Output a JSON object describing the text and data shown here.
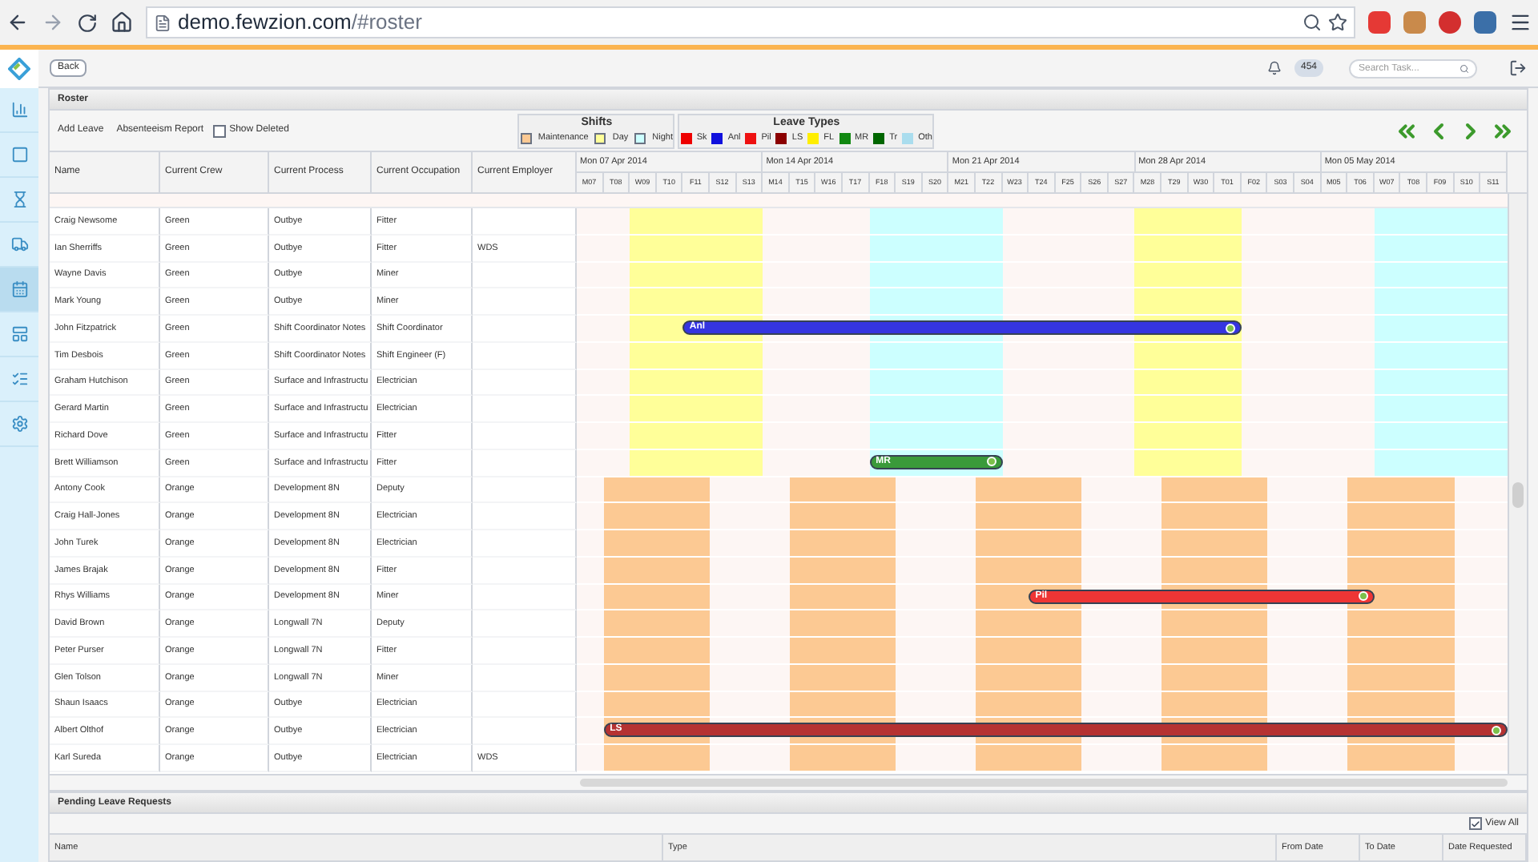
{
  "browser": {
    "url_host": "demo.fewzion.com",
    "url_path": "/#roster"
  },
  "header": {
    "back": "Back",
    "notifications": "454",
    "search": {
      "placeholder": "Search Task..."
    }
  },
  "sidebar": {
    "items": [
      {
        "kind": "chart",
        "selected": false
      },
      {
        "kind": "square",
        "selected": false
      },
      {
        "kind": "hourglass",
        "selected": false
      },
      {
        "kind": "truck",
        "selected": false
      },
      {
        "kind": "calendar",
        "selected": true
      },
      {
        "kind": "board",
        "selected": false
      },
      {
        "kind": "list",
        "selected": false
      },
      {
        "kind": "gear",
        "selected": false
      }
    ]
  },
  "roster": {
    "title": "Roster",
    "toolbar": {
      "add_leave": "Add Leave",
      "absenteeism": "Absenteeism Report",
      "show_deleted": {
        "label": "Show Deleted",
        "checked": false
      }
    },
    "shifts": {
      "title": "Shifts",
      "items": [
        {
          "kind": "maintenance",
          "label": "Maintenance",
          "color": "#fcc993"
        },
        {
          "kind": "day",
          "label": "Day",
          "color": "#ffff99"
        },
        {
          "kind": "night",
          "label": "Night",
          "color": "#ccffff"
        }
      ]
    },
    "leave_types": {
      "title": "Leave Types",
      "items": [
        {
          "label": "Sk",
          "color": "#ee0000"
        },
        {
          "label": "Anl",
          "color": "#1010dd"
        },
        {
          "label": "Pil",
          "color": "#ee1111"
        },
        {
          "label": "LS",
          "color": "#8b0000"
        },
        {
          "label": "FL",
          "color": "#ffee00"
        },
        {
          "label": "MR",
          "color": "#118811"
        },
        {
          "label": "Tr",
          "color": "#006600"
        },
        {
          "label": "Oth",
          "color": "#aaddee"
        }
      ]
    },
    "columns": [
      "Name",
      "Current Crew",
      "Current Process",
      "Current Occupation",
      "Current Employer"
    ],
    "weeks": [
      "Mon 07 Apr 2014",
      "Mon 14 Apr 2014",
      "Mon 21 Apr 2014",
      "Mon 28 Apr 2014",
      "Mon 05 May 2014"
    ],
    "days": [
      "M07",
      "T08",
      "W09",
      "T10",
      "F11",
      "S12",
      "S13",
      "M14",
      "T15",
      "W16",
      "T17",
      "F18",
      "S19",
      "S20",
      "M21",
      "T22",
      "W23",
      "T24",
      "F25",
      "S26",
      "S27",
      "M28",
      "T29",
      "W30",
      "T01",
      "F02",
      "S03",
      "S04",
      "M05",
      "T06",
      "W07",
      "T08",
      "F09",
      "S10",
      "S11"
    ],
    "shift_patterns": [
      {
        "kind": "green",
        "days": [
          {
            "kind": "none"
          },
          {
            "kind": "none"
          },
          {
            "kind": "day"
          },
          {
            "kind": "day"
          },
          {
            "kind": "day"
          },
          {
            "kind": "day"
          },
          {
            "kind": "day"
          },
          {
            "kind": "none"
          },
          {
            "kind": "none"
          },
          {
            "kind": "none"
          },
          {
            "kind": "none"
          },
          {
            "kind": "night"
          },
          {
            "kind": "night"
          },
          {
            "kind": "night"
          },
          {
            "kind": "night"
          },
          {
            "kind": "night"
          },
          {
            "kind": "none"
          },
          {
            "kind": "none"
          },
          {
            "kind": "none"
          },
          {
            "kind": "none"
          },
          {
            "kind": "none"
          },
          {
            "kind": "day"
          },
          {
            "kind": "day"
          },
          {
            "kind": "day"
          },
          {
            "kind": "day"
          },
          {
            "kind": "none"
          },
          {
            "kind": "none"
          },
          {
            "kind": "none"
          },
          {
            "kind": "none"
          },
          {
            "kind": "none"
          },
          {
            "kind": "night"
          },
          {
            "kind": "night"
          },
          {
            "kind": "night"
          },
          {
            "kind": "night"
          },
          {
            "kind": "night"
          }
        ]
      },
      {
        "kind": "orange",
        "days": [
          {
            "kind": "none"
          },
          {
            "kind": "maintenance"
          },
          {
            "kind": "maintenance"
          },
          {
            "kind": "maintenance"
          },
          {
            "kind": "maintenance"
          },
          {
            "kind": "none"
          },
          {
            "kind": "none"
          },
          {
            "kind": "none"
          },
          {
            "kind": "maintenance"
          },
          {
            "kind": "maintenance"
          },
          {
            "kind": "maintenance"
          },
          {
            "kind": "maintenance"
          },
          {
            "kind": "none"
          },
          {
            "kind": "none"
          },
          {
            "kind": "none"
          },
          {
            "kind": "maintenance"
          },
          {
            "kind": "maintenance"
          },
          {
            "kind": "maintenance"
          },
          {
            "kind": "maintenance"
          },
          {
            "kind": "none"
          },
          {
            "kind": "none"
          },
          {
            "kind": "none"
          },
          {
            "kind": "maintenance"
          },
          {
            "kind": "maintenance"
          },
          {
            "kind": "maintenance"
          },
          {
            "kind": "maintenance"
          },
          {
            "kind": "none"
          },
          {
            "kind": "none"
          },
          {
            "kind": "none"
          },
          {
            "kind": "maintenance"
          },
          {
            "kind": "maintenance"
          },
          {
            "kind": "maintenance"
          },
          {
            "kind": "maintenance"
          },
          {
            "kind": "none"
          },
          {
            "kind": "none"
          }
        ]
      }
    ],
    "rows": [
      {
        "kind": "green",
        "name": "Craig Newsome",
        "crew": "Green",
        "process": "Outbye",
        "occupation": "Fitter"
      },
      {
        "kind": "green",
        "name": "Ian Sherriffs",
        "crew": "Green",
        "process": "Outbye",
        "occupation": "Fitter",
        "employer": "WDS"
      },
      {
        "kind": "green",
        "name": "Wayne Davis",
        "crew": "Green",
        "process": "Outbye",
        "occupation": "Miner"
      },
      {
        "kind": "green",
        "name": "Mark Young",
        "crew": "Green",
        "process": "Outbye",
        "occupation": "Miner"
      },
      {
        "kind": "green",
        "name": "John Fitzpatrick",
        "crew": "Green",
        "process": "Shift Coordinator Notes",
        "occupation": "Shift Coordinator",
        "leave": {
          "label": "Anl",
          "color": "#3535e0",
          "days": [
            false,
            false,
            false,
            false,
            true,
            true,
            true,
            true,
            true,
            true,
            true,
            true,
            true,
            true,
            true,
            true,
            true,
            true,
            true,
            true,
            true,
            true,
            true,
            true,
            true,
            false,
            false,
            false,
            false,
            false,
            false,
            false,
            false,
            false,
            false
          ]
        }
      },
      {
        "kind": "green",
        "name": "Tim Desbois",
        "crew": "Green",
        "process": "Shift Coordinator Notes",
        "occupation": "Shift Engineer (F)"
      },
      {
        "kind": "green",
        "name": "Graham Hutchison",
        "crew": "Green",
        "process": "Surface and Infrastructu",
        "occupation": "Electrician"
      },
      {
        "kind": "green",
        "name": "Gerard Martin",
        "crew": "Green",
        "process": "Surface and Infrastructu",
        "occupation": "Electrician"
      },
      {
        "kind": "green",
        "name": "Richard Dove",
        "crew": "Green",
        "process": "Surface and Infrastructu",
        "occupation": "Fitter"
      },
      {
        "kind": "green",
        "name": "Brett Williamson",
        "crew": "Green",
        "process": "Surface and Infrastructu",
        "occupation": "Fitter",
        "leave": {
          "label": "MR",
          "color": "#3a9a3a",
          "days": [
            false,
            false,
            false,
            false,
            false,
            false,
            false,
            false,
            false,
            false,
            false,
            true,
            true,
            true,
            true,
            true,
            false,
            false,
            false,
            false,
            false,
            false,
            false,
            false,
            false,
            false,
            false,
            false,
            false,
            false,
            false,
            false,
            false,
            false,
            false
          ]
        }
      },
      {
        "kind": "orange",
        "name": "Antony Cook",
        "crew": "Orange",
        "process": "Development 8N",
        "occupation": "Deputy"
      },
      {
        "kind": "orange",
        "name": "Craig Hall-Jones",
        "crew": "Orange",
        "process": "Development 8N",
        "occupation": "Electrician"
      },
      {
        "kind": "orange",
        "name": "John Turek",
        "crew": "Orange",
        "process": "Development 8N",
        "occupation": "Electrician"
      },
      {
        "kind": "orange",
        "name": "James Brajak",
        "crew": "Orange",
        "process": "Development 8N",
        "occupation": "Fitter"
      },
      {
        "kind": "orange",
        "name": "Rhys Williams",
        "crew": "Orange",
        "process": "Development 8N",
        "occupation": "Miner",
        "leave": {
          "label": "Pil",
          "color": "#ee3535",
          "days": [
            false,
            false,
            false,
            false,
            false,
            false,
            false,
            false,
            false,
            false,
            false,
            false,
            false,
            false,
            false,
            false,
            false,
            true,
            true,
            true,
            true,
            true,
            true,
            true,
            true,
            true,
            true,
            true,
            true,
            true,
            false,
            false,
            false,
            false,
            false
          ]
        }
      },
      {
        "kind": "orange",
        "name": "David Brown",
        "crew": "Orange",
        "process": "Longwall 7N",
        "occupation": "Deputy"
      },
      {
        "kind": "orange",
        "name": "Peter Purser",
        "crew": "Orange",
        "process": "Longwall 7N",
        "occupation": "Fitter"
      },
      {
        "kind": "orange",
        "name": "Glen Tolson",
        "crew": "Orange",
        "process": "Longwall 7N",
        "occupation": "Miner"
      },
      {
        "kind": "orange",
        "name": "Shaun Isaacs",
        "crew": "Orange",
        "process": "Outbye",
        "occupation": "Electrician"
      },
      {
        "kind": "orange",
        "name": "Albert Olthof",
        "crew": "Orange",
        "process": "Outbye",
        "occupation": "Electrician",
        "leave": {
          "label": "LS",
          "color": "#b53232",
          "days": [
            false,
            true,
            true,
            true,
            true,
            true,
            true,
            true,
            true,
            true,
            true,
            true,
            true,
            true,
            true,
            true,
            true,
            true,
            true,
            true,
            true,
            true,
            true,
            true,
            true,
            true,
            true,
            true,
            true,
            true,
            true,
            true,
            true,
            true,
            true
          ]
        }
      },
      {
        "kind": "orange",
        "name": "Karl Sureda",
        "crew": "Orange",
        "process": "Outbye",
        "occupation": "Electrician",
        "employer": "WDS"
      }
    ]
  },
  "pending": {
    "title": "Pending Leave Requests",
    "view_all": {
      "label": "View All",
      "checked": true
    },
    "columns": [
      "Name",
      "Type",
      "From Date",
      "To Date",
      "Date Requested"
    ]
  }
}
